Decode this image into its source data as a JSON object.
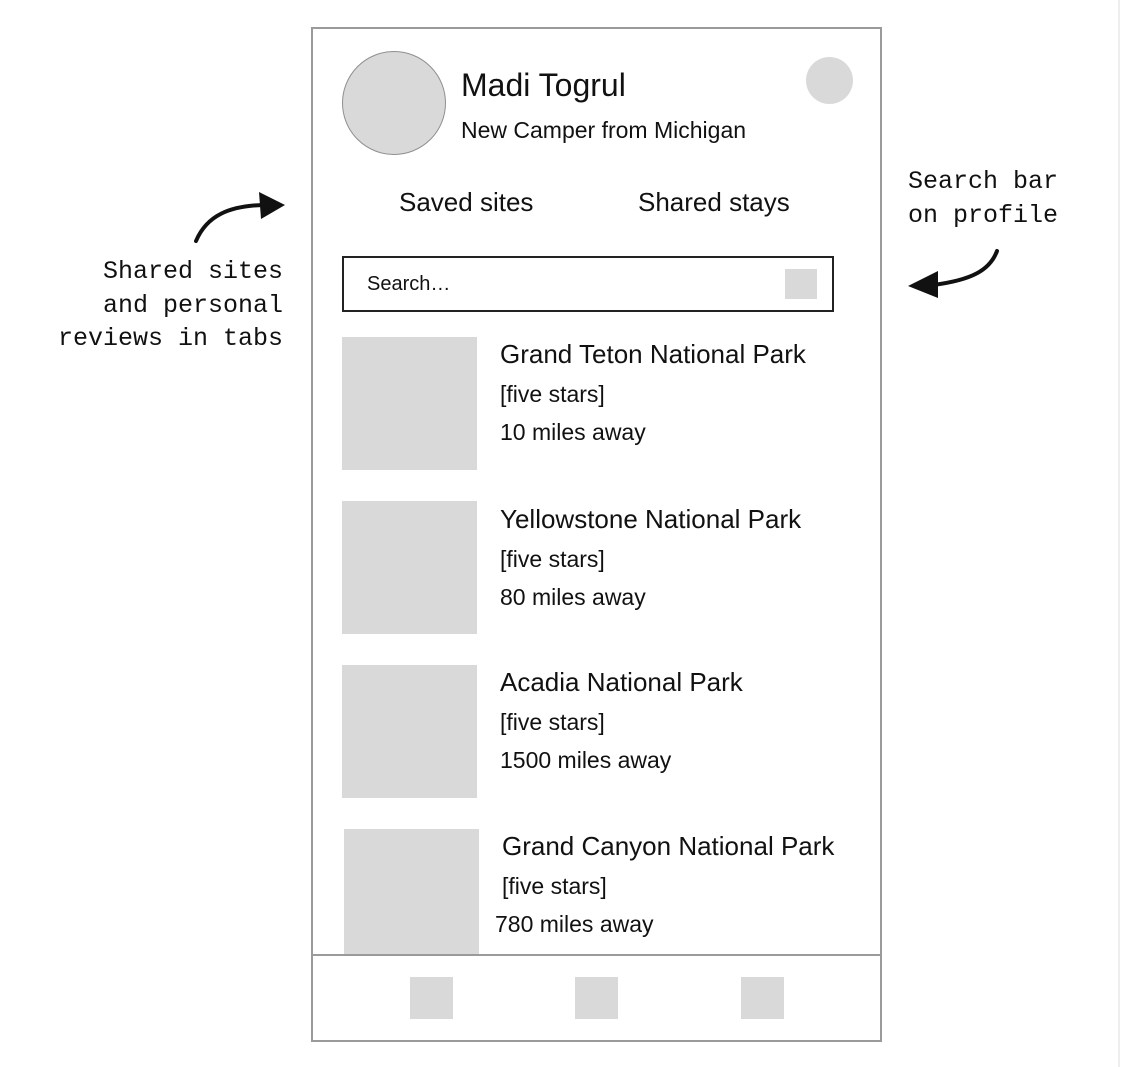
{
  "annotations": {
    "left_note": "Shared sites\nand personal\nreviews in tabs",
    "right_note": "Search bar\non profile"
  },
  "profile": {
    "name": "Madi Togrul",
    "subtitle": "New Camper from Michigan"
  },
  "tabs": [
    {
      "label": "Saved sites"
    },
    {
      "label": "Shared stays"
    }
  ],
  "search": {
    "placeholder": "Search…"
  },
  "parks": [
    {
      "name": "Grand Teton National Park",
      "rating": "[five stars]",
      "distance": "10 miles away"
    },
    {
      "name": "Yellowstone National Park",
      "rating": "[five stars]",
      "distance": "80 miles away"
    },
    {
      "name": "Acadia National Park",
      "rating": "[five stars]",
      "distance": "1500 miles away"
    },
    {
      "name": "Grand Canyon National Park",
      "rating": "[five stars]",
      "distance": "780 miles away"
    }
  ],
  "colors": {
    "placeholder_fill": "#d9d9d9",
    "frame_border": "#9a9a9a",
    "text": "#111111"
  }
}
